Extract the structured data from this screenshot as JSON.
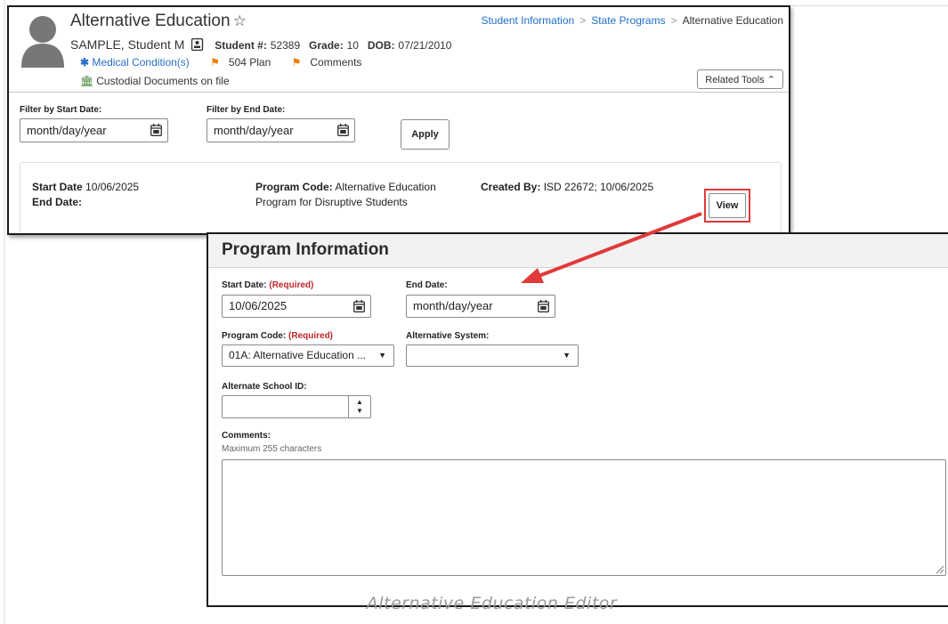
{
  "header": {
    "title": "Alternative Education",
    "student_name": "SAMPLE, Student M",
    "student_num_label": "Student #:",
    "student_num": "52389",
    "grade_label": "Grade:",
    "grade": "10",
    "dob_label": "DOB:",
    "dob": "07/21/2010",
    "alerts": {
      "medical": "Medical Condition(s)",
      "plan504": "504 Plan",
      "comments": "Comments",
      "custodial": "Custodial Documents on file"
    },
    "related_tools": "Related Tools",
    "breadcrumb": [
      "Student Information",
      "State Programs",
      "Alternative Education"
    ]
  },
  "filters": {
    "start_label": "Filter by Start Date:",
    "start_placeholder": "month/day/year",
    "end_label": "Filter by End Date:",
    "end_placeholder": "month/day/year",
    "apply": "Apply"
  },
  "record": {
    "start_label": "Start Date",
    "start_value": "10/06/2025",
    "end_label": "End Date:",
    "program_code_label": "Program Code:",
    "program_code_value": "Alternative Education",
    "program_code_value2": "Program for Disruptive Students",
    "created_by_label": "Created By:",
    "created_by_value": "ISD 22672; 10/06/2025",
    "view": "View"
  },
  "program_info": {
    "title": "Program Information",
    "start_label": "Start Date:",
    "required": "(Required)",
    "start_value": "10/06/2025",
    "end_label": "End Date:",
    "end_placeholder": "month/day/year",
    "program_code_label": "Program Code:",
    "program_code_value": "01A: Alternative Education ...",
    "alt_system_label": "Alternative System:",
    "alt_system_value": "",
    "school_id_label": "Alternate School ID:",
    "school_id_value": "",
    "comments_label": "Comments:",
    "comments_hint": "Maximum 255 characters"
  },
  "caption": "Alternative Education Editor",
  "colors": {
    "link": "#1f6fc7",
    "highlight": "#e03a3a",
    "required": "#c0272d",
    "flag": "#f07d00"
  }
}
